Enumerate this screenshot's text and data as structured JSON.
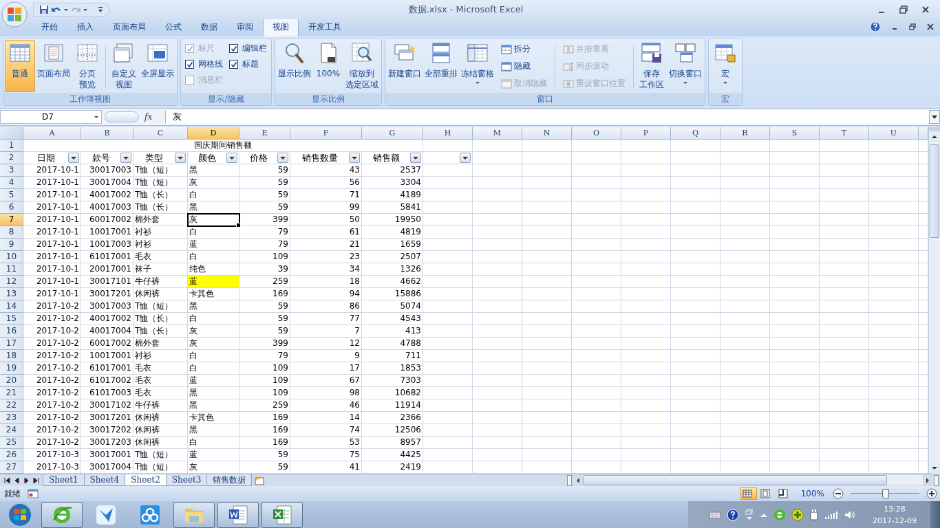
{
  "window": {
    "title": "数据.xlsx - Microsoft Excel"
  },
  "ribbon": {
    "tabs": [
      {
        "label": "开始",
        "selected": false
      },
      {
        "label": "插入",
        "selected": false
      },
      {
        "label": "页面布局",
        "selected": false
      },
      {
        "label": "公式",
        "selected": false
      },
      {
        "label": "数据",
        "selected": false
      },
      {
        "label": "审阅",
        "selected": false
      },
      {
        "label": "视图",
        "selected": true
      },
      {
        "label": "开发工具",
        "selected": false
      }
    ],
    "groups": [
      {
        "label": "工作簿视图",
        "items": [
          {
            "kind": "large",
            "label": "普通",
            "selected": true,
            "dropdown": false
          },
          {
            "kind": "large",
            "label": "页面布局",
            "selected": false,
            "dropdown": false
          },
          {
            "kind": "large",
            "lines": [
              "分页",
              "预览"
            ],
            "selected": false,
            "dropdown": false
          },
          {
            "kind": "separator"
          },
          {
            "kind": "large",
            "lines": [
              "自定义",
              "视图"
            ],
            "selected": false,
            "dropdown": false
          },
          {
            "kind": "large",
            "label": "全屏显示",
            "selected": false,
            "dropdown": false
          }
        ]
      },
      {
        "label": "显示/隐藏",
        "items": [
          {
            "kind": "stack",
            "items": [
              {
                "kind": "check",
                "label": "标尺",
                "checked": true,
                "disabled": true
              },
              {
                "kind": "check",
                "label": "网格线",
                "checked": true,
                "disabled": false
              },
              {
                "kind": "check",
                "label": "消息栏",
                "checked": false,
                "disabled": true
              }
            ]
          },
          {
            "kind": "stack",
            "items": [
              {
                "kind": "check",
                "label": "编辑栏",
                "checked": true,
                "disabled": false
              },
              {
                "kind": "check",
                "label": "标题",
                "checked": true,
                "disabled": false
              }
            ]
          }
        ]
      },
      {
        "label": "显示比例",
        "items": [
          {
            "kind": "large",
            "label": "显示比例",
            "selected": false,
            "dropdown": false
          },
          {
            "kind": "large",
            "label": "100%",
            "selected": false,
            "dropdown": false
          },
          {
            "kind": "large",
            "lines": [
              "缩放到",
              "选定区域"
            ],
            "selected": false,
            "dropdown": false
          }
        ]
      },
      {
        "label": "窗口",
        "items": [
          {
            "kind": "large",
            "label": "新建窗口",
            "selected": false,
            "dropdown": false
          },
          {
            "kind": "large",
            "label": "全部重排",
            "selected": false,
            "dropdown": false
          },
          {
            "kind": "large",
            "label": "冻结窗格",
            "selected": false,
            "dropdown": true
          },
          {
            "kind": "stack",
            "items": [
              {
                "kind": "small",
                "label": "拆分",
                "disabled": false
              },
              {
                "kind": "small",
                "label": "隐藏",
                "disabled": false
              },
              {
                "kind": "small",
                "label": "取消隐藏",
                "disabled": true
              }
            ]
          },
          {
            "kind": "separator"
          },
          {
            "kind": "stack",
            "items": [
              {
                "kind": "small",
                "label": "并排查看",
                "disabled": true
              },
              {
                "kind": "small",
                "label": "同步滚动",
                "disabled": true
              },
              {
                "kind": "small",
                "label": "重设窗口位置",
                "disabled": true
              }
            ]
          },
          {
            "kind": "separator"
          },
          {
            "kind": "large",
            "lines": [
              "保存",
              "工作区"
            ],
            "selected": false,
            "dropdown": false
          },
          {
            "kind": "large",
            "label": "切换窗口",
            "selected": false,
            "dropdown": true
          }
        ]
      },
      {
        "label": "宏",
        "items": [
          {
            "kind": "large",
            "label": "宏",
            "selected": false,
            "dropdown": true
          }
        ]
      }
    ]
  },
  "formula_bar": {
    "name_box": "D7",
    "function_label": "fx",
    "formula": "灰"
  },
  "sheet": {
    "columns": [
      {
        "label": "A",
        "kind": "number",
        "selected": false
      },
      {
        "label": "B",
        "kind": "number",
        "selected": false
      },
      {
        "label": "C",
        "kind": "text",
        "selected": false
      },
      {
        "label": "D",
        "kind": "text",
        "selected": true
      },
      {
        "label": "E",
        "kind": "number",
        "selected": false
      },
      {
        "label": "F",
        "kind": "number",
        "selected": false
      },
      {
        "label": "G",
        "kind": "number",
        "selected": false
      },
      {
        "label": "H",
        "selected": false
      },
      {
        "label": "M",
        "selected": false
      },
      {
        "label": "N",
        "selected": false
      },
      {
        "label": "O",
        "selected": false
      },
      {
        "label": "P",
        "selected": false
      },
      {
        "label": "Q",
        "selected": false
      },
      {
        "label": "R",
        "selected": false
      },
      {
        "label": "S",
        "selected": false
      },
      {
        "label": "T",
        "selected": false
      },
      {
        "label": "U",
        "selected": false
      }
    ],
    "rows": [
      {
        "number": "1",
        "kind": "title",
        "selected": false,
        "title": "国庆期间销售额"
      },
      {
        "number": "2",
        "kind": "header",
        "selected": false,
        "cells": [
          {
            "text": "日期",
            "filter": true
          },
          {
            "text": "款号",
            "filter": true
          },
          {
            "text": "类型",
            "filter": true
          },
          {
            "text": "颜色",
            "filter": true
          },
          {
            "text": "价格",
            "filter": true
          },
          {
            "text": "销售数量",
            "filter": true
          },
          {
            "text": "销售额",
            "filter": true
          },
          {
            "filter": true
          }
        ]
      },
      {
        "number": "3",
        "kind": "data",
        "selected": false,
        "cells": [
          "2017-10-1",
          "30017003",
          "T恤（短）",
          "黑",
          "59",
          "43",
          "2537"
        ]
      },
      {
        "number": "4",
        "kind": "data",
        "selected": false,
        "cells": [
          "2017-10-1",
          "30017004",
          "T恤（短）",
          "灰",
          "59",
          "56",
          "3304"
        ]
      },
      {
        "number": "5",
        "kind": "data",
        "selected": false,
        "cells": [
          "2017-10-1",
          "40017002",
          "T恤（长）",
          "白",
          "59",
          "71",
          "4189"
        ]
      },
      {
        "number": "6",
        "kind": "data",
        "selected": false,
        "cells": [
          "2017-10-1",
          "40017003",
          "T恤（长）",
          "黑",
          "59",
          "99",
          "5841"
        ]
      },
      {
        "number": "7",
        "kind": "data",
        "selected": true,
        "cells": [
          "2017-10-1",
          "60017002",
          "棉外套",
          "灰",
          "399",
          "50",
          "19950"
        ]
      },
      {
        "number": "8",
        "kind": "data",
        "selected": false,
        "cells": [
          "2017-10-1",
          "10017001",
          "衬衫",
          "白",
          "79",
          "61",
          "4819"
        ]
      },
      {
        "number": "9",
        "kind": "data",
        "selected": false,
        "cells": [
          "2017-10-1",
          "10017003",
          "衬衫",
          "蓝",
          "79",
          "21",
          "1659"
        ]
      },
      {
        "number": "10",
        "kind": "data",
        "selected": false,
        "cells": [
          "2017-10-1",
          "61017001",
          "毛衣",
          "白",
          "109",
          "23",
          "2507"
        ]
      },
      {
        "number": "11",
        "kind": "data",
        "selected": false,
        "cells": [
          "2017-10-1",
          "20017001",
          "袜子",
          "纯色",
          "39",
          "34",
          "1326"
        ]
      },
      {
        "number": "12",
        "kind": "data",
        "selected": false,
        "cells": [
          "2017-10-1",
          "30017101",
          "牛仔裤",
          {
            "text": "蓝",
            "color": "#ffff00"
          },
          "259",
          "18",
          "4662"
        ]
      },
      {
        "number": "13",
        "kind": "data",
        "selected": false,
        "cells": [
          "2017-10-1",
          "30017201",
          "休闲裤",
          "卡其色",
          "169",
          "94",
          "15886"
        ]
      },
      {
        "number": "14",
        "kind": "data",
        "selected": false,
        "cells": [
          "2017-10-2",
          "30017003",
          "T恤（短）",
          "黑",
          "59",
          "86",
          "5074"
        ]
      },
      {
        "number": "15",
        "kind": "data",
        "selected": false,
        "cells": [
          "2017-10-2",
          "40017002",
          "T恤（长）",
          "白",
          "59",
          "77",
          "4543"
        ]
      },
      {
        "number": "16",
        "kind": "data",
        "selected": false,
        "cells": [
          "2017-10-2",
          "40017004",
          "T恤（长）",
          "灰",
          "59",
          "7",
          "413"
        ]
      },
      {
        "number": "17",
        "kind": "data",
        "selected": false,
        "cells": [
          "2017-10-2",
          "60017002",
          "棉外套",
          "灰",
          "399",
          "12",
          "4788"
        ]
      },
      {
        "number": "18",
        "kind": "data",
        "selected": false,
        "cells": [
          "2017-10-2",
          "10017001",
          "衬衫",
          "白",
          "79",
          "9",
          "711"
        ]
      },
      {
        "number": "19",
        "kind": "data",
        "selected": false,
        "cells": [
          "2017-10-2",
          "61017001",
          "毛衣",
          "白",
          "109",
          "17",
          "1853"
        ]
      },
      {
        "number": "20",
        "kind": "data",
        "selected": false,
        "cells": [
          "2017-10-2",
          "61017002",
          "毛衣",
          "蓝",
          "109",
          "67",
          "7303"
        ]
      },
      {
        "number": "21",
        "kind": "data",
        "selected": false,
        "cells": [
          "2017-10-2",
          "61017003",
          "毛衣",
          "黑",
          "109",
          "98",
          "10682"
        ]
      },
      {
        "number": "22",
        "kind": "data",
        "selected": false,
        "cells": [
          "2017-10-2",
          "30017102",
          "牛仔裤",
          "黑",
          "259",
          "46",
          "11914"
        ]
      },
      {
        "number": "23",
        "kind": "data",
        "selected": false,
        "cells": [
          "2017-10-2",
          "30017201",
          "休闲裤",
          "卡其色",
          "169",
          "14",
          "2366"
        ]
      },
      {
        "number": "24",
        "kind": "data",
        "selected": false,
        "cells": [
          "2017-10-2",
          "30017202",
          "休闲裤",
          "黑",
          "169",
          "74",
          "12506"
        ]
      },
      {
        "number": "25",
        "kind": "data",
        "selected": false,
        "cells": [
          "2017-10-2",
          "30017203",
          "休闲裤",
          "白",
          "169",
          "53",
          "8957"
        ]
      },
      {
        "number": "26",
        "kind": "data",
        "selected": false,
        "cells": [
          "2017-10-3",
          "30017001",
          "T恤（短）",
          "蓝",
          "59",
          "75",
          "4425"
        ]
      },
      {
        "number": "27",
        "kind": "data",
        "selected": false,
        "cells": [
          "2017-10-3",
          "30017004",
          "T恤（短）",
          "灰",
          "59",
          "41",
          "2419"
        ]
      }
    ],
    "sheet_tabs": [
      {
        "label": "Sheet1",
        "selected": false
      },
      {
        "label": "Sheet4",
        "selected": false
      },
      {
        "label": "Sheet2",
        "selected": true
      },
      {
        "label": "Sheet3",
        "selected": false
      },
      {
        "label": "销售数据",
        "selected": false
      }
    ]
  },
  "status_bar": {
    "text": "就绪",
    "views": [
      {
        "selected": true
      },
      {
        "selected": false
      },
      {
        "selected": false
      }
    ],
    "zoom": "100%",
    "zoom_slider": {
      "level": 0.5
    }
  },
  "taskbar": {
    "apps": [
      {
        "running": true
      },
      {
        "running": false
      },
      {
        "running": false
      },
      {
        "running": true
      },
      {
        "running": true
      },
      {
        "running": true
      }
    ],
    "clock": {
      "time": "13:28",
      "date": "2017-12-09"
    }
  }
}
